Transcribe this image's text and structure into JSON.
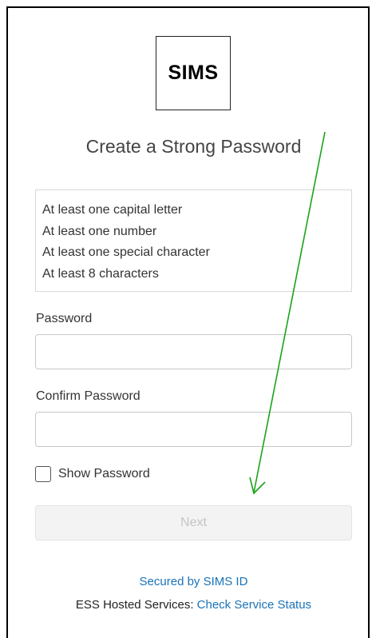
{
  "brand": {
    "logo_text": "SIMS"
  },
  "page": {
    "title": "Create a Strong Password"
  },
  "requirements": [
    "At least one capital letter",
    "At least one number",
    "At least one special character",
    "At least 8 characters"
  ],
  "form": {
    "password_label": "Password",
    "password_value": "",
    "confirm_label": "Confirm Password",
    "confirm_value": "",
    "show_password_label": "Show Password",
    "show_password_checked": false,
    "next_label": "Next",
    "next_enabled": false
  },
  "footer": {
    "secured_link": "Secured by SIMS ID",
    "hosted_prefix": "ESS Hosted Services: ",
    "status_link": "Check Service Status"
  },
  "annotation": {
    "arrow_color": "#1aa31a"
  }
}
